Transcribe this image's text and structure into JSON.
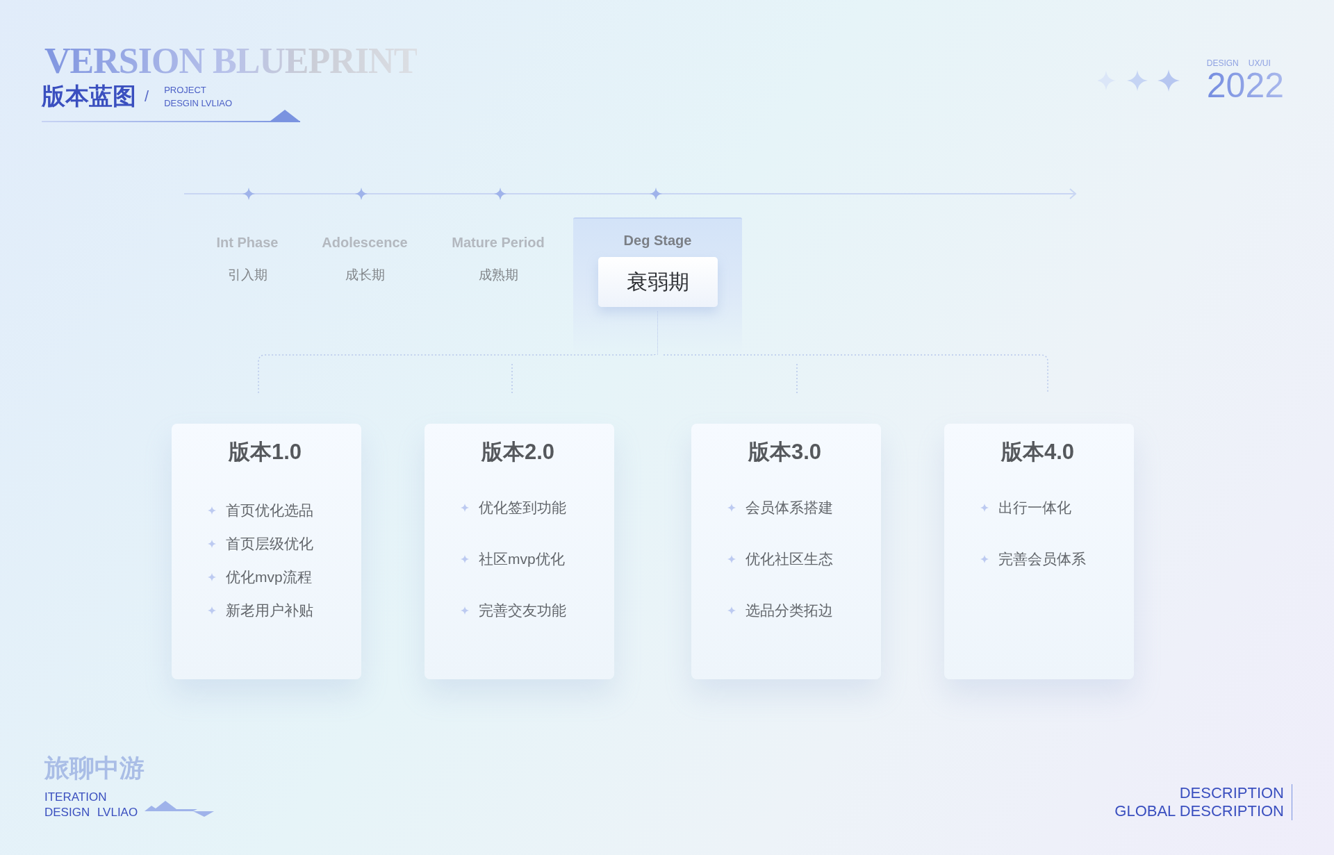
{
  "header": {
    "title": "VERSION BLUEPRINT",
    "subtitle": "版本蓝图",
    "separator": "/",
    "tagline": [
      "PROJECT",
      "DESGIN LVLIAO"
    ]
  },
  "badge": {
    "caption": [
      "DESIGN",
      "UX/UI"
    ],
    "year": "2022"
  },
  "stages": [
    {
      "label": "Int Phase",
      "name": "引入期",
      "selected": false
    },
    {
      "label": "Adolescence",
      "name": "成长期",
      "selected": false
    },
    {
      "label": "Mature Period",
      "name": "成熟期",
      "selected": false
    },
    {
      "label": "Deg Stage",
      "name": "衰弱期",
      "selected": true
    }
  ],
  "versions": [
    {
      "title": "版本1.0",
      "items": [
        "首页优化选品",
        "首页层级优化",
        "优化mvp流程",
        "新老用户补贴"
      ]
    },
    {
      "title": "版本2.0",
      "items": [
        "优化签到功能",
        "社区mvp优化",
        "完善交友功能"
      ]
    },
    {
      "title": "版本3.0",
      "items": [
        "会员体系搭建",
        "优化社区生态",
        "选品分类拓边"
      ]
    },
    {
      "title": "版本4.0",
      "items": [
        "出行一体化",
        "完善会员体系"
      ]
    }
  ],
  "footer": {
    "brand": "旅聊中游",
    "lines": [
      "ITERATION",
      "DESIGN LVLIAO"
    ],
    "description": [
      "DESCRIPTION",
      "GLOBAL DESCRIPTION"
    ]
  }
}
